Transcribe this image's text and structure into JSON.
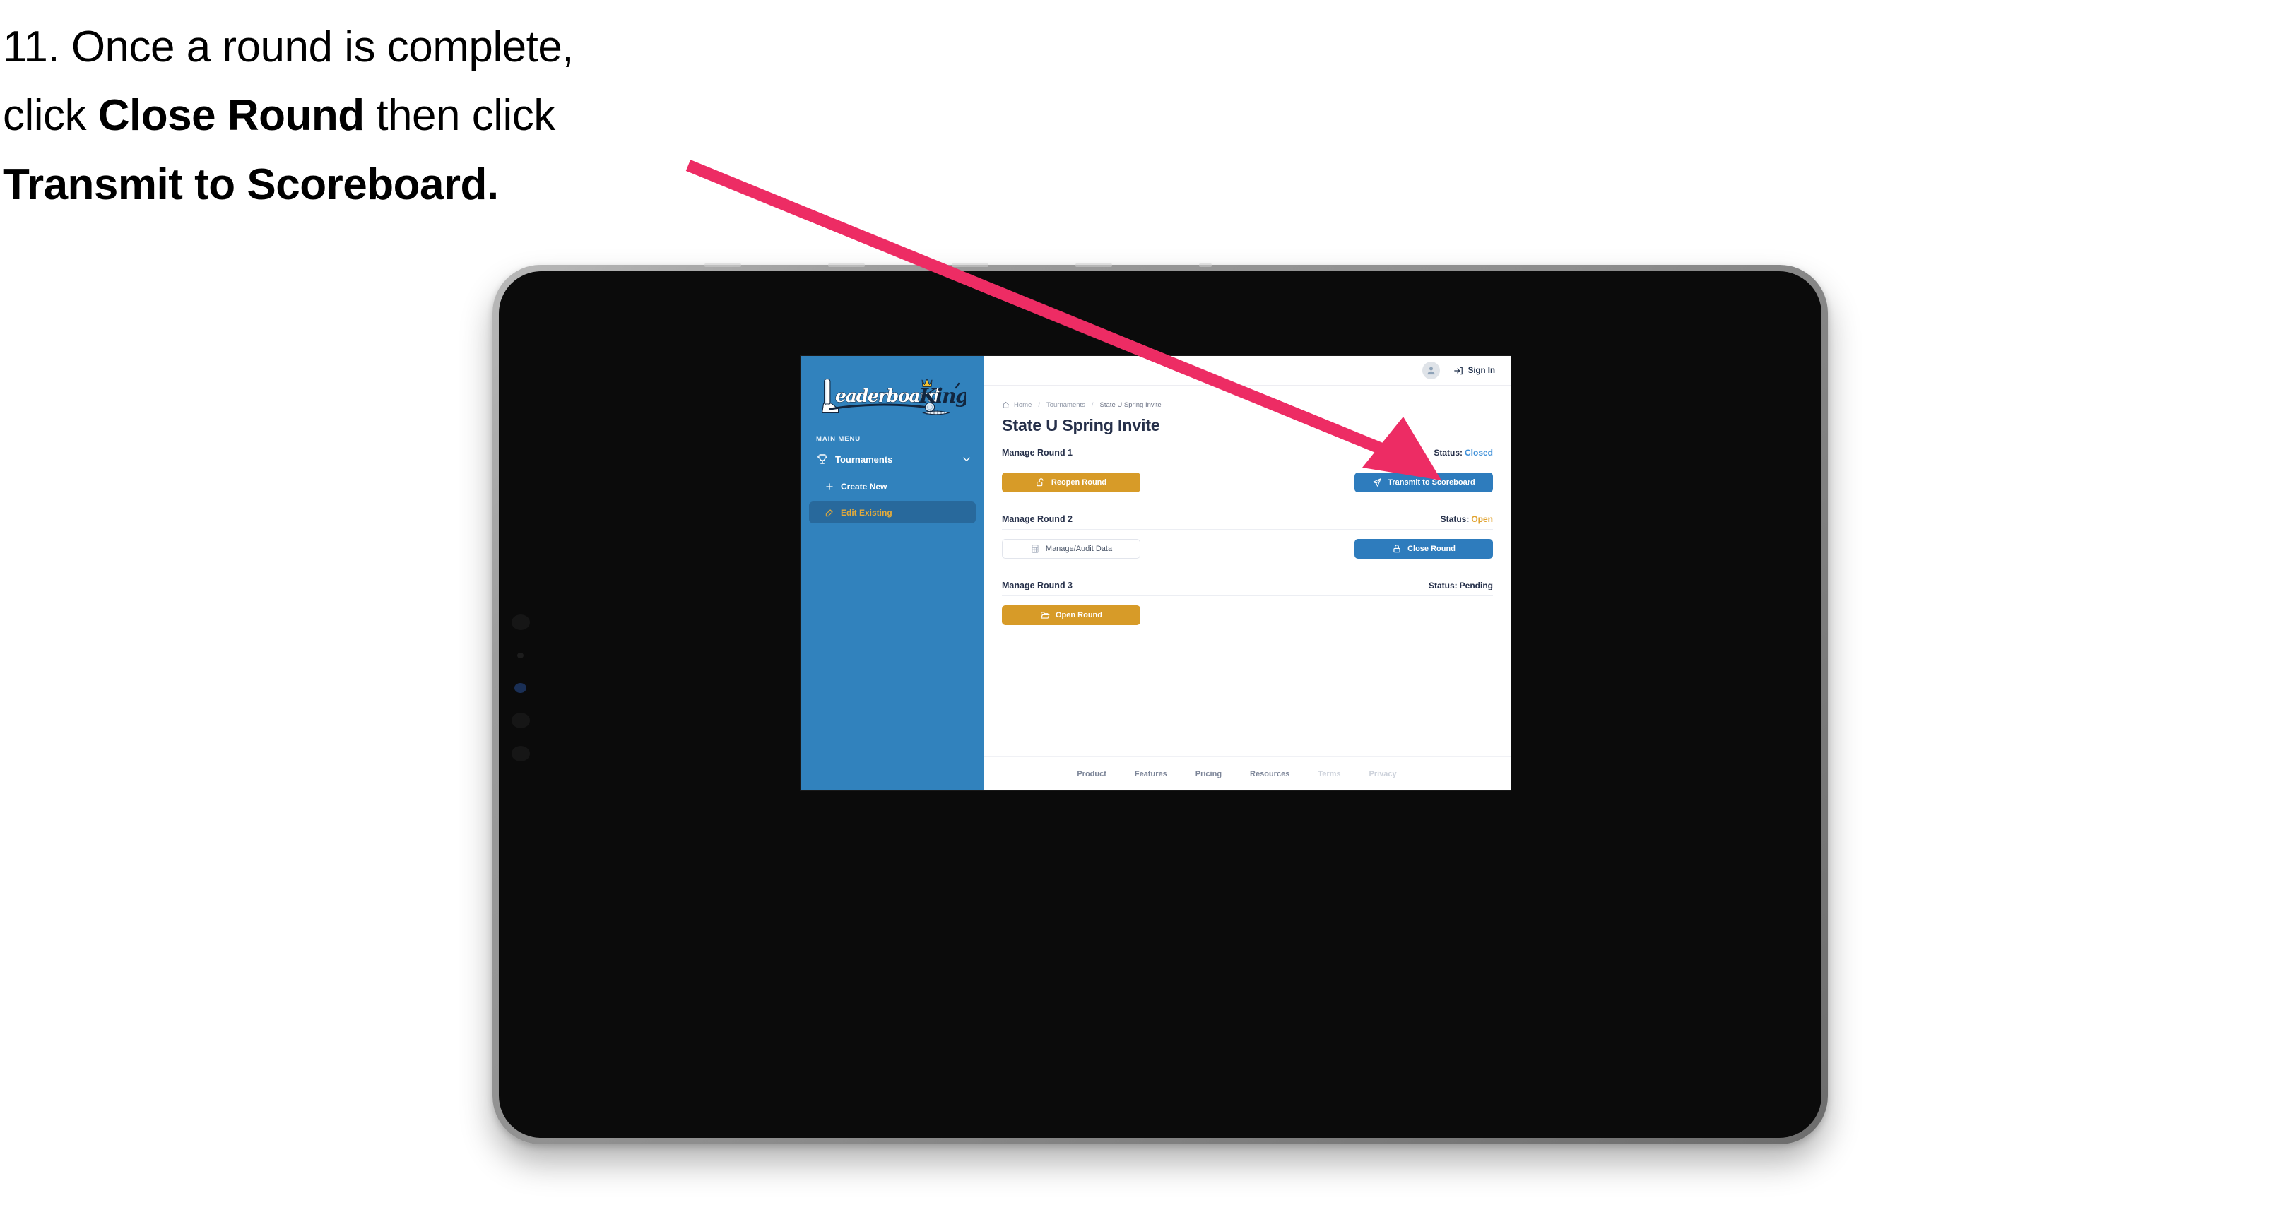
{
  "instruction": {
    "number": "11.",
    "line1_a": "11. Once a round is complete,",
    "line2_a": "click ",
    "line2_bold": "Close Round",
    "line2_b": " then click",
    "line3_bold": "Transmit to Scoreboard."
  },
  "annotation": {
    "arrow_color": "#ED2C64",
    "points_to": "Transmit to Scoreboard"
  },
  "device": {
    "type": "tablet",
    "frame_color": "#8d8d8d",
    "bezel_color": "#0b0b0b"
  },
  "sidebar": {
    "logo": {
      "word_one": "Leaderboard",
      "word_two": "King",
      "icon": "golf-club-and-crown-logo",
      "word_one_color": "#ffffff",
      "word_two_color": "#12263f",
      "crown_color": "#f0c030"
    },
    "background_color": "#3182bd",
    "section_label": "MAIN MENU",
    "items": [
      {
        "label": "Tournaments",
        "icon": "trophy-icon",
        "expanded": true,
        "chevron": "chevron-down-icon",
        "active": false
      },
      {
        "label": "Create New",
        "icon": "plus-icon",
        "active": false,
        "sub": true
      },
      {
        "label": "Edit Existing",
        "icon": "pencil-edit-icon",
        "active": true,
        "sub": true
      }
    ],
    "active_item_bg": "#28699c",
    "active_item_color": "#e3ab3b"
  },
  "topbar": {
    "avatar_icon": "user-avatar-icon",
    "signin_icon": "login-arrow-icon",
    "signin_label": "Sign In"
  },
  "breadcrumb": {
    "home_icon": "home-icon",
    "items": [
      "Home",
      "Tournaments",
      "State U Spring Invite"
    ],
    "separator": "/"
  },
  "page": {
    "title": "State U Spring Invite"
  },
  "rounds": [
    {
      "title": "Manage Round 1",
      "status_label": "Status:",
      "status_value": "Closed",
      "status_class": "closed",
      "left_button": {
        "label": "Reopen Round",
        "icon": "unlock-icon",
        "style": "amber"
      },
      "right_button": {
        "label": "Transmit to Scoreboard",
        "icon": "paper-plane-icon",
        "style": "blue"
      }
    },
    {
      "title": "Manage Round 2",
      "status_label": "Status:",
      "status_value": "Open",
      "status_class": "open",
      "left_button": {
        "label": "Manage/Audit Data",
        "icon": "grid-table-icon",
        "style": "ghost"
      },
      "right_button": {
        "label": "Close Round",
        "icon": "lock-icon",
        "style": "blue"
      }
    },
    {
      "title": "Manage Round 3",
      "status_label": "Status:",
      "status_value": "Pending",
      "status_class": "pending",
      "left_button": {
        "label": "Open Round",
        "icon": "open-folder-icon",
        "style": "amber"
      },
      "right_button": null
    }
  ],
  "footer": {
    "links": [
      {
        "label": "Product",
        "muted": false
      },
      {
        "label": "Features",
        "muted": false
      },
      {
        "label": "Pricing",
        "muted": false
      },
      {
        "label": "Resources",
        "muted": false
      },
      {
        "label": "Terms",
        "muted": true
      },
      {
        "label": "Privacy",
        "muted": true
      }
    ]
  },
  "cursor": {
    "type": "pointing-hand-cursor",
    "over": "Edit Existing"
  },
  "colors": {
    "brand_blue": "#3182bd",
    "button_blue": "#2e7cbd",
    "amber": "#d79b28",
    "status_open": "#e0a22e",
    "status_closed": "#3d8fd8",
    "navy_text": "#26304a",
    "arrow_pink": "#ED2C64"
  }
}
